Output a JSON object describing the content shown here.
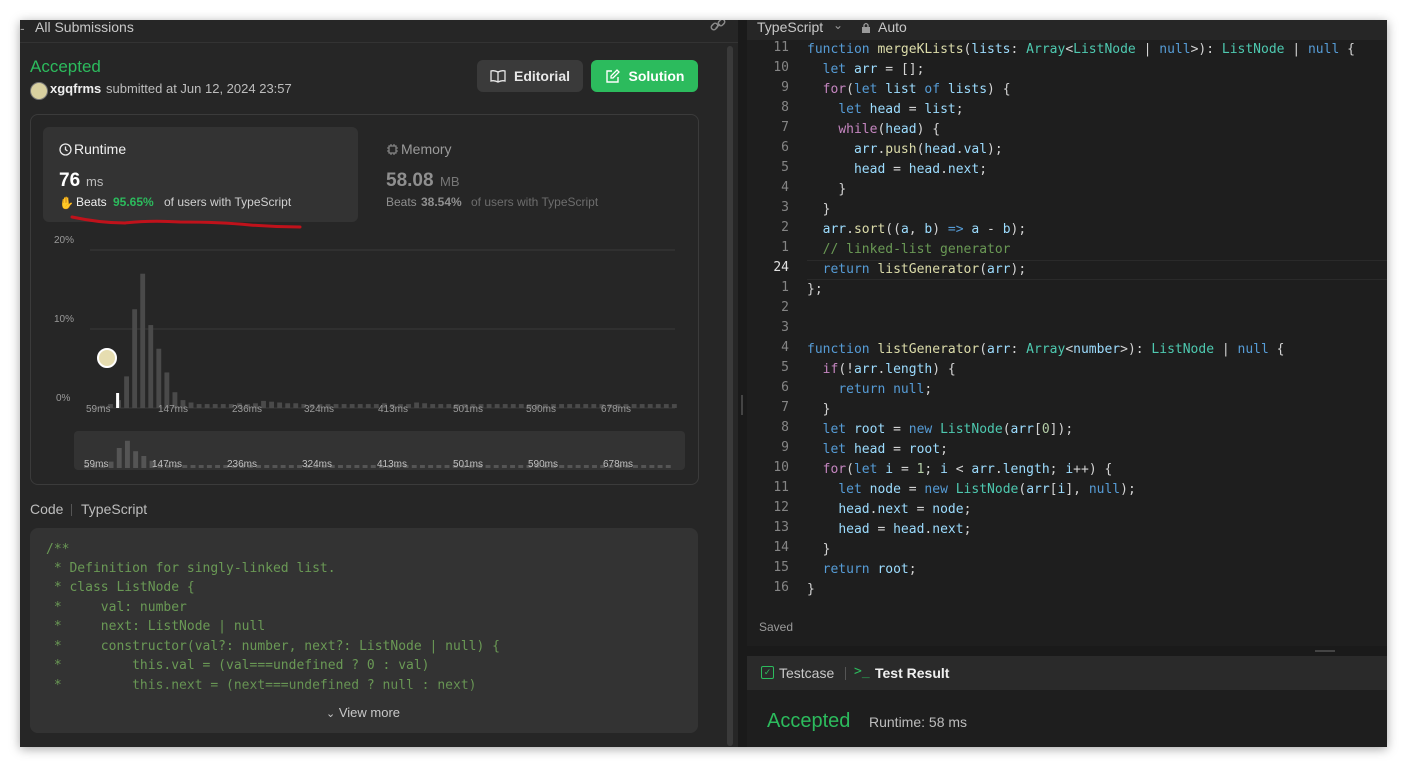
{
  "left_header": {
    "title": "All Submissions"
  },
  "submission": {
    "status": "Accepted",
    "user": "xgqfrms",
    "submitted_text": "submitted at Jun 12, 2024 23:57",
    "editorial_label": "Editorial",
    "solution_label": "Solution"
  },
  "runtime": {
    "label": "Runtime",
    "value": "76",
    "unit": "ms",
    "beats_prefix": "Beats",
    "beats_pct": "95.65%",
    "beats_suffix": "of users with TypeScript"
  },
  "memory": {
    "label": "Memory",
    "value": "58.08",
    "unit": "MB",
    "beats_prefix": "Beats",
    "beats_pct": "38.54%",
    "beats_suffix": "of users with TypeScript"
  },
  "chart_data": {
    "type": "bar",
    "title": "",
    "xlabel": "",
    "ylabel": "",
    "y_ticks": [
      "20%",
      "10%",
      "0%"
    ],
    "x_ticks": [
      "59ms",
      "147ms",
      "236ms",
      "324ms",
      "413ms",
      "501ms",
      "590ms",
      "678ms"
    ],
    "ylim": [
      0,
      20
    ],
    "values": [
      0.3,
      0.5,
      1.0,
      4.0,
      12.5,
      17.0,
      10.5,
      7.5,
      4.5,
      2.0,
      1.0,
      0.7,
      0.5,
      0.5,
      0.5,
      0.5,
      0.5,
      0.6,
      0.5,
      0.6,
      0.9,
      0.8,
      0.7,
      0.6,
      0.6,
      0.5,
      0.5,
      0.5,
      0.5,
      0.5,
      0.5,
      0.5,
      0.5,
      0.5,
      0.5,
      0.6,
      0.5,
      0.5,
      0.5,
      0.7,
      0.6,
      0.5,
      0.5,
      0.5,
      0.5,
      0.5,
      0.5,
      0.5,
      0.5,
      0.5,
      0.5,
      0.5,
      0.5,
      0.5,
      0.5,
      0.5,
      0.5,
      0.5,
      0.5,
      0.5,
      0.5,
      0.5,
      0.5,
      0.5,
      0.5,
      0.5,
      0.5,
      0.5,
      0.5,
      0.5,
      0.5,
      0.5
    ],
    "highlight_marker": "76ms",
    "colors": {
      "bars": "#4a4a4a",
      "accent": "#2cbb5d",
      "grid": "#3a3a3a"
    }
  },
  "code_section": {
    "label": "Code",
    "lang": "TypeScript",
    "lines": [
      "/**",
      " * Definition for singly-linked list.",
      " * class ListNode {",
      " *     val: number",
      " *     next: ListNode | null",
      " *     constructor(val?: number, next?: ListNode | null) {",
      " *         this.val = (val===undefined ? 0 : val)",
      " *         this.next = (next===undefined ? null : next)"
    ],
    "view_more": "View more"
  },
  "editor": {
    "lang": "TypeScript",
    "mode": "Auto",
    "line_numbers": [
      "11",
      "10",
      "9",
      "8",
      "7",
      "6",
      "5",
      "4",
      "3",
      "2",
      "1",
      "24",
      "1",
      "2",
      "3",
      "4",
      "5",
      "6",
      "7",
      "8",
      "9",
      "10",
      "11",
      "12",
      "13",
      "14",
      "15",
      "16"
    ],
    "code": [
      "function mergeKLists(lists: Array<ListNode | null>): ListNode | null {",
      "  let arr = [];",
      "  for(let list of lists) {",
      "    let head = list;",
      "    while(head) {",
      "      arr.push(head.val);",
      "      head = head.next;",
      "    }",
      "  }",
      "  arr.sort((a, b) => a - b);",
      "  // linked-list generator",
      "  return listGenerator(arr);",
      "};",
      "",
      "",
      "function listGenerator(arr: Array<number>): ListNode | null {",
      "  if(!arr.length) {",
      "    return null;",
      "  }",
      "  let root = new ListNode(arr[0]);",
      "  let head = root;",
      "  for(let i = 1; i < arr.length; i++) {",
      "    let node = new ListNode(arr[i], null);",
      "    head.next = node;",
      "    head = head.next;",
      "  }",
      "  return root;",
      "}"
    ],
    "status": "Saved"
  },
  "test_panel": {
    "tab_testcase": "Testcase",
    "tab_result": "Test Result",
    "result": "Accepted",
    "runtime_text": "Runtime: 58 ms"
  }
}
